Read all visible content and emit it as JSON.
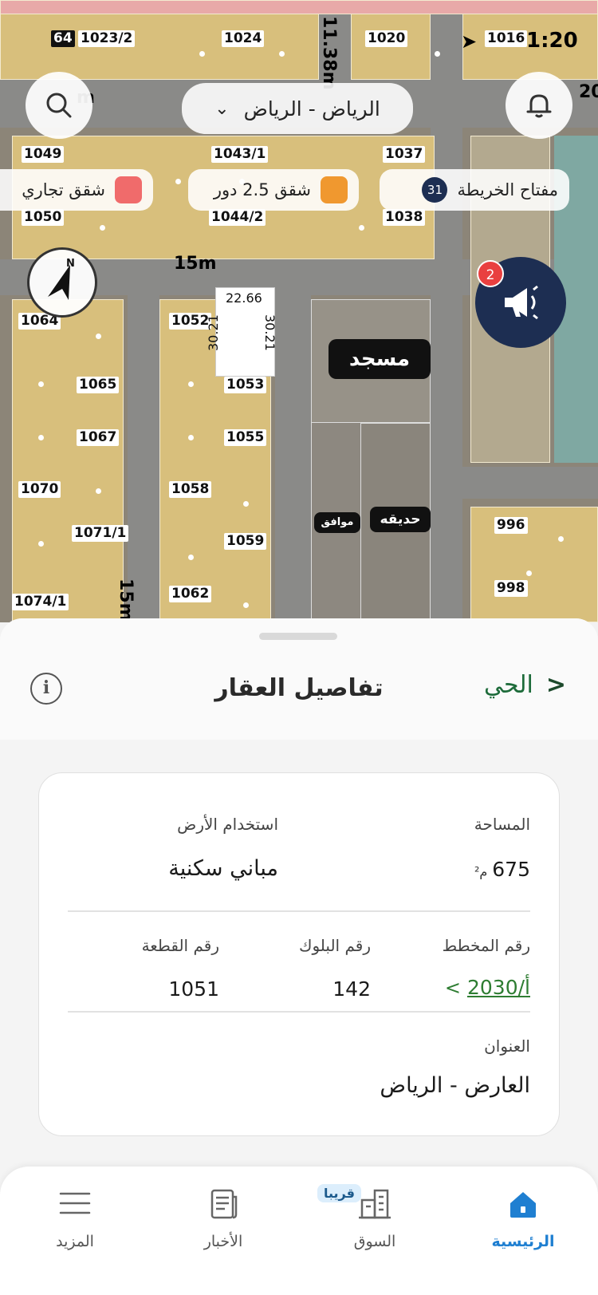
{
  "status_bar": {
    "time_fragment": "1:20",
    "partial_lot": "1023/2",
    "partial_left": "64"
  },
  "map": {
    "city_selector": "الرياض - الرياض",
    "map_key_label": "مفتاح الخريطة",
    "map_key_count": "31",
    "legend": [
      {
        "label": "شقق 2.5 دور",
        "color": "#f0982f"
      },
      {
        "label": "شقق تجاري",
        "color": "#f06b6b"
      }
    ],
    "notification_count": "2",
    "street_15m_top": "15m",
    "street_15m_left": "15m",
    "street_11m": "11.38m",
    "street_20": "20",
    "street_m": "m",
    "dimension_top": "22.66",
    "dimension_left": "30.21",
    "dimension_right": "30.21",
    "mosque_label": "مسجد",
    "park_label": "حديقه",
    "approved_label": "موافق",
    "lots": {
      "l1024": "1024",
      "l1020": "1020",
      "l1016": "1016",
      "l1049": "1049",
      "l1043": "1043/1",
      "l1037": "1037",
      "l1050": "1050",
      "l1044": "1044/2",
      "l1038": "1038",
      "l1064": "1064",
      "l1052": "1052",
      "l1065": "1065",
      "l1053": "1053",
      "l1067": "1067",
      "l1055": "1055",
      "l1070": "1070",
      "l1058": "1058",
      "l1071": "1071/1",
      "l1059": "1059",
      "l1074": "1074/1",
      "l1062": "1062",
      "l996": "996",
      "l998": "998"
    }
  },
  "sheet": {
    "title": "تفاصيل العقار",
    "neighborhood_link": "الحي",
    "area_label": "المساحة",
    "area_value": "675",
    "area_unit": "م²",
    "land_use_label": "استخدام الأرض",
    "land_use_value": "مباني سكنية",
    "plan_label": "رقم المخطط",
    "plan_value": "2030/أ",
    "block_label": "رقم البلوك",
    "block_value": "142",
    "parcel_label": "رقم القطعة",
    "parcel_value": "1051",
    "address_label": "العنوان",
    "address_value": "العارض - الرياض"
  },
  "tabbar": {
    "home": "الرئيسية",
    "market": "السوق",
    "soon_badge": "قريبا",
    "news": "الأخبار",
    "more": "المزيد",
    "active_color": "#1f7fd1"
  }
}
